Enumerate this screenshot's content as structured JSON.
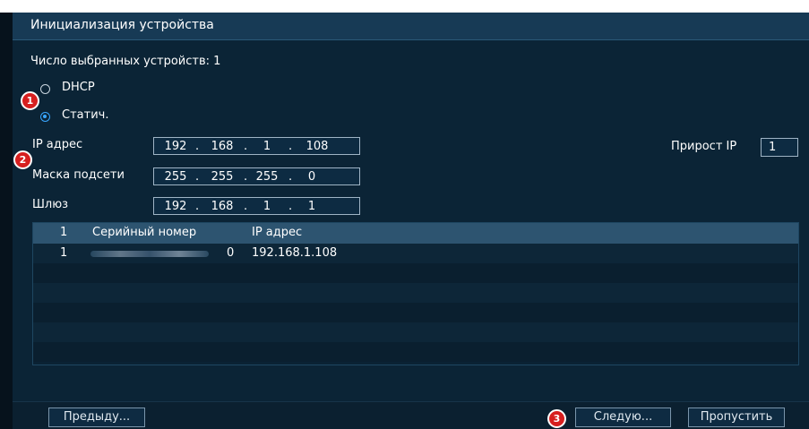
{
  "window": {
    "title": "Инициализация устройства"
  },
  "selected_count_label": "Число выбранных устройств: 1",
  "mode": {
    "dhcp_label": "DHCP",
    "static_label": "Статич.",
    "selected": "static"
  },
  "network": {
    "ip_label": "IP адрес",
    "ip": [
      "192",
      "168",
      "1",
      "108"
    ],
    "mask_label": "Маска подсети",
    "mask": [
      "255",
      "255",
      "255",
      "0"
    ],
    "gateway_label": "Шлюз",
    "gateway": [
      "192",
      "168",
      "1",
      "1"
    ],
    "ip_increment_label": "Прирост IP",
    "ip_increment_value": "1"
  },
  "table": {
    "headers": [
      "1",
      "Серийный номер",
      "IP адрес"
    ],
    "rows": [
      {
        "num": "1",
        "serial_tail": "0",
        "ip": "192.168.1.108"
      }
    ]
  },
  "buttons": {
    "prev": "Предыду...",
    "next": "Следую...",
    "skip": "Пропустить"
  },
  "badges": [
    "1",
    "2",
    "3"
  ],
  "colors": {
    "background": "#0b2436",
    "titlebar": "#173a55",
    "table_header": "#2d5470",
    "radio_selected": "#39a7ff",
    "badge": "#d71f1f"
  }
}
